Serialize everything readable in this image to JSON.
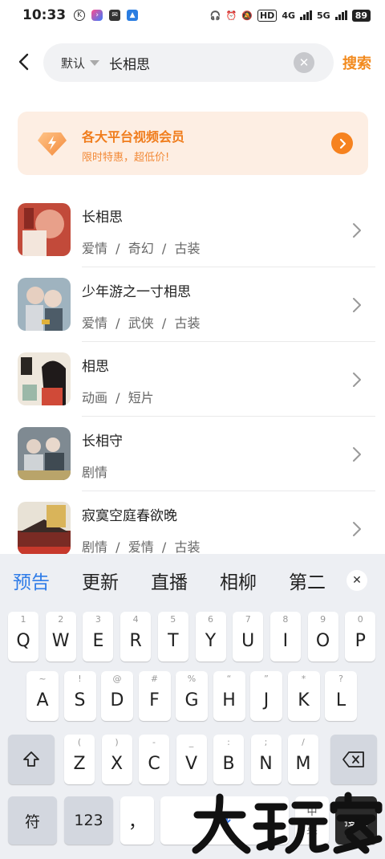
{
  "status_bar": {
    "time": "10:33",
    "net1": "4G",
    "net2": "5G",
    "hd": "HD",
    "battery": "89"
  },
  "search": {
    "type_label": "默认",
    "query": "长相思",
    "button": "搜索"
  },
  "banner": {
    "title": "各大平台视频会员",
    "subtitle": "限时特惠，超低价!"
  },
  "results": [
    {
      "title": "长相思",
      "tags": "爱情  /  奇幻  /  古装"
    },
    {
      "title": "少年游之一寸相思",
      "tags": "爱情  /  武侠  /  古装"
    },
    {
      "title": "相思",
      "tags": "动画  /  短片"
    },
    {
      "title": "长相守",
      "tags": "剧情"
    },
    {
      "title": "寂寞空庭春欲晚",
      "tags": "剧情  /  爱情  /  古装"
    }
  ],
  "keyboard": {
    "candidates": [
      "预告",
      "更新",
      "直播",
      "相柳",
      "第二"
    ],
    "row1": [
      {
        "key": "Q",
        "sub": "1"
      },
      {
        "key": "W",
        "sub": "2"
      },
      {
        "key": "E",
        "sub": "3"
      },
      {
        "key": "R",
        "sub": "4"
      },
      {
        "key": "T",
        "sub": "5"
      },
      {
        "key": "Y",
        "sub": "6"
      },
      {
        "key": "U",
        "sub": "7"
      },
      {
        "key": "I",
        "sub": "8"
      },
      {
        "key": "O",
        "sub": "9"
      },
      {
        "key": "P",
        "sub": "0"
      }
    ],
    "row2": [
      {
        "key": "A",
        "sub": "~"
      },
      {
        "key": "S",
        "sub": "!"
      },
      {
        "key": "D",
        "sub": "@"
      },
      {
        "key": "F",
        "sub": "#"
      },
      {
        "key": "G",
        "sub": "%"
      },
      {
        "key": "H",
        "sub": "“"
      },
      {
        "key": "J",
        "sub": "”"
      },
      {
        "key": "K",
        "sub": "*"
      },
      {
        "key": "L",
        "sub": "?"
      }
    ],
    "row3": [
      {
        "key": "Z",
        "sub": "("
      },
      {
        "key": "X",
        "sub": ")"
      },
      {
        "key": "C",
        "sub": "-"
      },
      {
        "key": "V",
        "sub": "_"
      },
      {
        "key": "B",
        "sub": ":"
      },
      {
        "key": "N",
        "sub": ";"
      },
      {
        "key": "M",
        "sub": "/"
      }
    ],
    "symbol_key": "符",
    "number_key": "123",
    "comma_key": "，",
    "lang_key": "中",
    "lang_sub": "英",
    "search_key": "搜索"
  },
  "watermark": "大玩家",
  "colors": {
    "accent_orange": "#f28a1e",
    "candidate_blue": "#2f7ce8",
    "banner_bg": "#fdeee3"
  }
}
